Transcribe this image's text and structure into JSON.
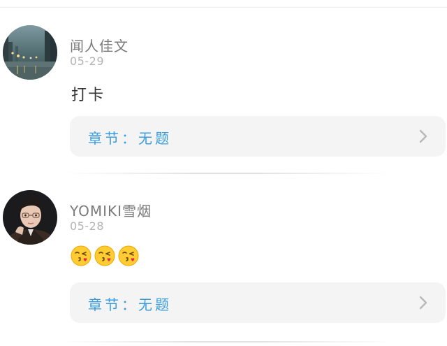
{
  "comments": [
    {
      "author": "闻人佳文",
      "date": "05-29",
      "text": "打卡",
      "chapter_label": "章节：无题"
    },
    {
      "author": "YOMIKI雪烟",
      "date": "05-28",
      "emojis": [
        "face-blowing-kiss-icon",
        "face-blowing-kiss-icon",
        "face-blowing-kiss-icon"
      ],
      "chapter_label": "章节：无题"
    }
  ],
  "colors": {
    "chapter_link_text": "#3a9de0",
    "chapter_link_bg": "#f4f4f4",
    "author_text": "#7a7a7a",
    "date_text": "#b3b3b3"
  }
}
